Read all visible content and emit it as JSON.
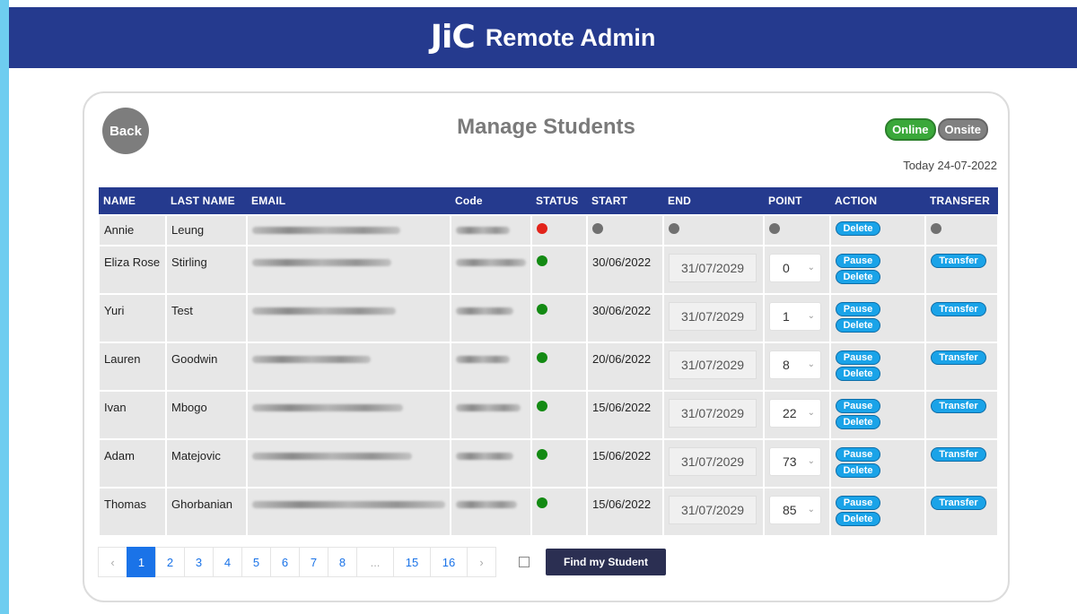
{
  "header": {
    "logo_text": "JiC",
    "title": "Remote Admin"
  },
  "card": {
    "back_label": "Back",
    "title": "Manage Students",
    "modes": [
      "Online",
      "Onsite"
    ],
    "today": "Today 24-07-2022"
  },
  "columns": [
    "NAME",
    "LAST NAME",
    "EMAIL",
    "Code",
    "STATUS",
    "START",
    "END",
    "POINT",
    "ACTION",
    "TRANSFER"
  ],
  "actions": {
    "pause": "Pause",
    "delete": "Delete",
    "transfer": "Transfer"
  },
  "students": [
    {
      "first": "Annie",
      "last": "Leung",
      "status": "red",
      "start": "",
      "end": "",
      "point": "",
      "active": false
    },
    {
      "first": "Eliza Rose",
      "last": "Stirling",
      "status": "green",
      "start": "30/06/2022",
      "end": "31/07/2029",
      "point": "0",
      "active": true
    },
    {
      "first": "Yuri",
      "last": "Test",
      "status": "green",
      "start": "30/06/2022",
      "end": "31/07/2029",
      "point": "1",
      "active": true
    },
    {
      "first": "Lauren",
      "last": "Goodwin",
      "status": "green",
      "start": "20/06/2022",
      "end": "31/07/2029",
      "point": "8",
      "active": true
    },
    {
      "first": "Ivan",
      "last": "Mbogo",
      "status": "green",
      "start": "15/06/2022",
      "end": "31/07/2029",
      "point": "22",
      "active": true
    },
    {
      "first": "Adam",
      "last": "Matejovic",
      "status": "green",
      "start": "15/06/2022",
      "end": "31/07/2029",
      "point": "73",
      "active": true
    },
    {
      "first": "Thomas",
      "last": "Ghorbanian",
      "status": "green",
      "start": "15/06/2022",
      "end": "31/07/2029",
      "point": "85",
      "active": true
    }
  ],
  "pagination": {
    "prev": "‹",
    "next": "›",
    "pages": [
      "1",
      "2",
      "3",
      "4",
      "5",
      "6",
      "7",
      "8",
      "...",
      "15",
      "16"
    ],
    "current": "1"
  },
  "find_label": "Find my Student",
  "colors": {
    "brand": "#253a8e",
    "accent": "#1aa3e8",
    "online": "#3aa83a"
  }
}
